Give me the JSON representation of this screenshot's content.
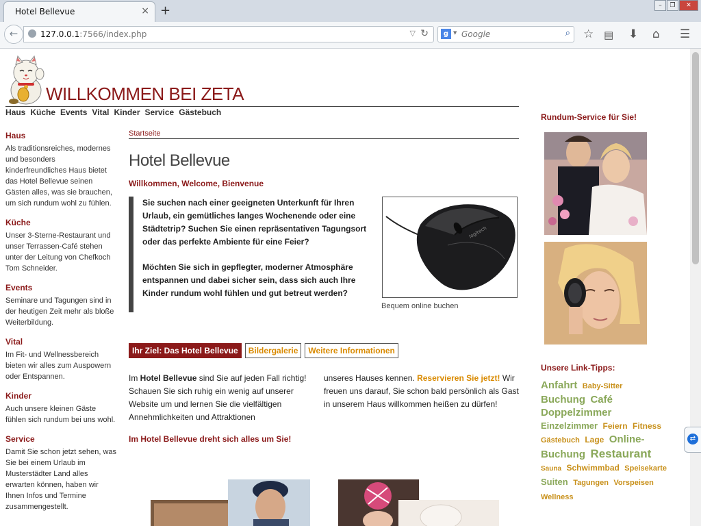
{
  "browser": {
    "tab_title": "Hotel Bellevue",
    "tab_close": "×",
    "new_tab": "+",
    "url_host": "127.0.0.1",
    "url_rest": ":7566/index.php",
    "search_placeholder": "Google",
    "search_engine_letter": "g"
  },
  "site": {
    "title": "WILLKOMMEN BEI ZETA",
    "nav": [
      "Haus",
      "Küche",
      "Events",
      "Vital",
      "Kinder",
      "Service",
      "Gästebuch"
    ]
  },
  "sidebar": [
    {
      "heading": "Haus",
      "text": "Als traditionsreiches, modernes und besonders kinderfreundliches Haus bietet das Hotel Bellevue seinen Gästen alles, was sie brauchen, um sich rundum wohl zu fühlen."
    },
    {
      "heading": "Küche",
      "text": "Unser 3-Sterne-Restaurant und unser Terrassen-Café stehen unter der Leitung von Chefkoch Tom Schneider."
    },
    {
      "heading": "Events",
      "text": "Seminare und Tagungen sind in der heutigen Zeit mehr als bloße Weiterbildung."
    },
    {
      "heading": "Vital",
      "text": "Im Fit- und Wellnessbereich bieten wir alles zum Auspowern oder Entspannen."
    },
    {
      "heading": "Kinder",
      "text": "Auch unsere kleinen Gäste fühlen sich rundum bei uns wohl."
    },
    {
      "heading": "Service",
      "text": "Damit Sie schon jetzt sehen, was Sie bei einem Urlaub im Musterstädter Land alles erwarten können, haben wir Ihnen Infos und Termine zusammengestellt."
    }
  ],
  "main": {
    "breadcrumb": "Startseite",
    "title": "Hotel Bellevue",
    "welcome": "Willkommen, Welcome, Bienvenue",
    "intro_p1": "Sie suchen nach einer geeigneten Unterkunft für Ihren Urlaub, ein gemütliches langes Wochenende oder eine Städtetrip? Suchen Sie einen repräsentativen Tagungsort oder das perfekte Ambiente für eine Feier?",
    "intro_p2": "Möchten Sie sich in gepflegter, moderner Atmosphäre entspannen und dabei sicher sein, dass sich auch Ihre Kinder rundum wohl fühlen und gut betreut werden?",
    "image_caption": "Bequem online buchen",
    "tabs": [
      "Ihr Ziel: Das Hotel Bellevue",
      "Bildergalerie",
      "Weitere Informationen"
    ],
    "col1_pre": "Im ",
    "col1_bold": "Hotel Bellevue",
    "col1_post": " sind Sie auf jeden Fall richtig! Schauen Sie sich ruhig ein wenig auf unserer Website um und lernen Sie die vielfältigen Annehmlichkeiten und Attraktionen",
    "col2_pre": "unseres Hauses kennen. ",
    "col2_link": "Reservieren Sie jetzt!",
    "col2_post": " Wir freuen uns darauf, Sie schon bald persönlich als Gast in unserem Haus willkommen heißen zu dürfen!",
    "tagline": "Im Hotel Bellevue dreht sich alles um Sie!"
  },
  "right": {
    "service_title": "Rundum-Service für Sie!",
    "links_title": "Unsere Link-Tipps:",
    "tags": [
      {
        "text": "Anfahrt",
        "size": "large",
        "color": "#8aa85a"
      },
      {
        "text": "Baby-Sitter",
        "size": "small",
        "color": "#c8901a"
      },
      {
        "text": "Buchung",
        "size": "large",
        "color": "#8aa85a"
      },
      {
        "text": "Café",
        "size": "large",
        "color": "#8aa85a"
      },
      {
        "text": "Doppelzimmer",
        "size": "large",
        "color": "#8aa85a"
      },
      {
        "text": "Einzelzimmer",
        "size": "medium",
        "color": "#8aa85a"
      },
      {
        "text": "Feiern",
        "size": "small2",
        "color": "#c8901a"
      },
      {
        "text": "Fitness",
        "size": "small2",
        "color": "#c8901a"
      },
      {
        "text": "Gästebuch",
        "size": "small",
        "color": "#c8901a"
      },
      {
        "text": "Lage",
        "size": "small2",
        "color": "#c8901a"
      },
      {
        "text": "Online-Buchung",
        "size": "large",
        "color": "#8aa85a"
      },
      {
        "text": "Restaurant",
        "size": "xlarge",
        "color": "#8aa85a"
      },
      {
        "text": "Sauna",
        "size": "tiny",
        "color": "#c8901a"
      },
      {
        "text": "Schwimmbad",
        "size": "small2",
        "color": "#c8901a"
      },
      {
        "text": "Speisekarte",
        "size": "small",
        "color": "#c8901a"
      },
      {
        "text": "Suiten",
        "size": "medium",
        "color": "#8aa85a"
      },
      {
        "text": "Tagungen",
        "size": "small",
        "color": "#c8901a"
      },
      {
        "text": "Vorspeisen",
        "size": "small",
        "color": "#c8901a"
      },
      {
        "text": "Wellness",
        "size": "small",
        "color": "#c8901a"
      }
    ]
  },
  "colors": {
    "brand": "#8b1a1a",
    "accent": "#d98a00",
    "tag_green": "#8aa85a",
    "tag_gold": "#c8901a"
  }
}
